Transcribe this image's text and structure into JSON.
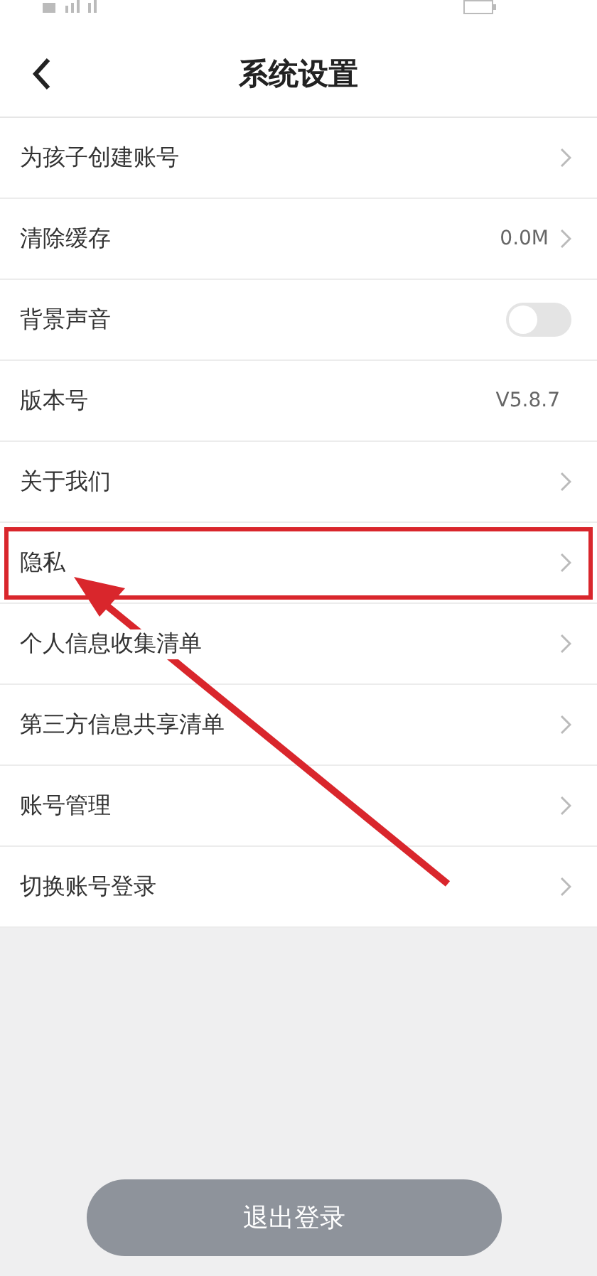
{
  "header": {
    "title": "系统设置"
  },
  "items": [
    {
      "kind": "link",
      "label": "为孩子创建账号",
      "annotated": false
    },
    {
      "kind": "link",
      "label": "清除缓存",
      "value": "0.0M",
      "annotated": false
    },
    {
      "kind": "toggle",
      "label": "背景声音",
      "on": false,
      "annotated": false
    },
    {
      "kind": "value",
      "label": "版本号",
      "value": "V5.8.7",
      "annotated": false
    },
    {
      "kind": "link",
      "label": "关于我们",
      "annotated": false
    },
    {
      "kind": "link",
      "label": "隐私",
      "annotated": true
    },
    {
      "kind": "link",
      "label": "个人信息收集清单",
      "annotated": false
    },
    {
      "kind": "link",
      "label": "第三方信息共享清单",
      "annotated": false
    },
    {
      "kind": "link",
      "label": "账号管理",
      "annotated": false
    },
    {
      "kind": "link",
      "label": "切换账号登录",
      "annotated": false
    }
  ],
  "logout_button": {
    "label": "退出登录"
  }
}
